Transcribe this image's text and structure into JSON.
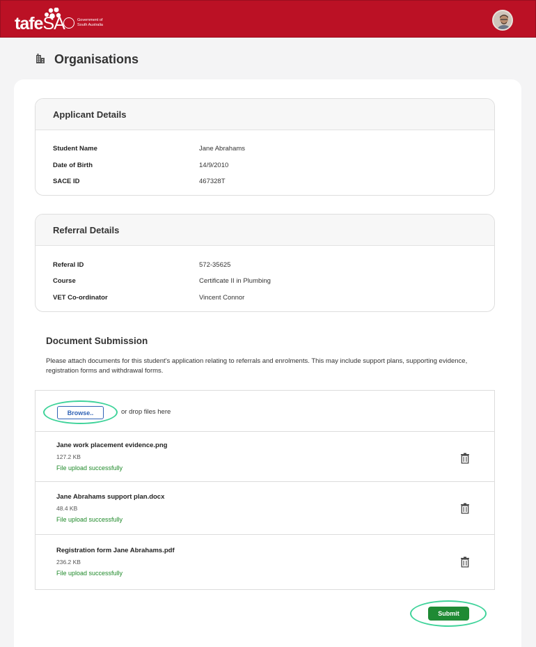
{
  "header": {
    "logo_main": "tafe",
    "logo_suffix": "SA",
    "gov_line1": "Government of",
    "gov_line2": "South Australia",
    "brand_color": "#bb1125"
  },
  "page": {
    "title": "Organisations",
    "title_icon": "building-icon"
  },
  "applicant": {
    "heading": "Applicant Details",
    "rows": [
      {
        "label": "Student Name",
        "value": "Jane Abrahams"
      },
      {
        "label": "Date of Birth",
        "value": "14/9/2010"
      },
      {
        "label": "SACE ID",
        "value": "467328T"
      }
    ]
  },
  "referral": {
    "heading": "Referral Details",
    "rows": [
      {
        "label": "Referal ID",
        "value": "572-35625"
      },
      {
        "label": "Course",
        "value": "Certificate II in Plumbing"
      },
      {
        "label": "VET Co-ordinator",
        "value": "Vincent Connor"
      }
    ]
  },
  "documents": {
    "heading": "Document Submission",
    "description": "Please attach documents for this student's application relating to referrals and enrolments.  This may include support plans, supporting evidence, registration forms and withdrawal forms.",
    "browse_label": "Browse..",
    "drop_text": "or drop files here",
    "files": [
      {
        "name": "Jane work placement evidence.png",
        "size": "127.2 KB",
        "status": "File upload successfully"
      },
      {
        "name": "Jane Abrahams support plan.docx",
        "size": "48.4 KB",
        "status": "File upload successfully"
      },
      {
        "name": "Registration form Jane Abrahams.pdf",
        "size": "236.2 KB",
        "status": "File upload successfully"
      }
    ]
  },
  "actions": {
    "submit_label": "Submit",
    "submit_color": "#1f8a34",
    "highlight_color": "#3fd39a"
  }
}
